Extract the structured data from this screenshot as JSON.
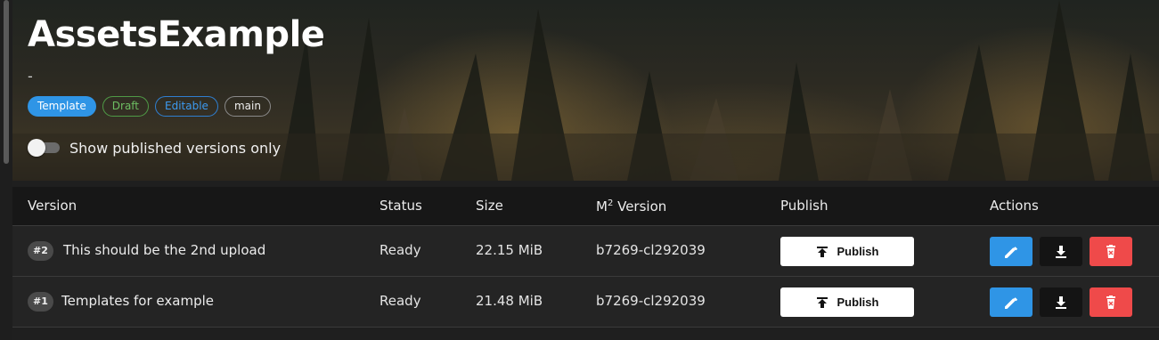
{
  "header": {
    "title": "AssetsExample",
    "subtitle": "-",
    "badges": [
      "Template",
      "Draft",
      "Editable",
      "main"
    ],
    "toggle_label": "Show published versions only",
    "toggle_on": false
  },
  "table": {
    "columns": {
      "version": "Version",
      "status": "Status",
      "size": "Size",
      "m2_base": "M",
      "m2_sup": "2",
      "m2_rest": " Version",
      "publish": "Publish",
      "actions": "Actions"
    },
    "rows": [
      {
        "num": "#2",
        "version": "This should be the 2nd upload",
        "status": "Ready",
        "size": "22.15 MiB",
        "m2_version": "b7269-cl292039",
        "publish_label": "Publish"
      },
      {
        "num": "#1",
        "version": "Templates for example",
        "status": "Ready",
        "size": "21.48 MiB",
        "m2_version": "b7269-cl292039",
        "publish_label": "Publish"
      }
    ],
    "action_icons": [
      "pencil-icon",
      "download-icon",
      "trash-icon"
    ]
  },
  "colors": {
    "accent": "#2f95e6",
    "danger": "#ef4a4a",
    "draft": "#6dbd62"
  }
}
